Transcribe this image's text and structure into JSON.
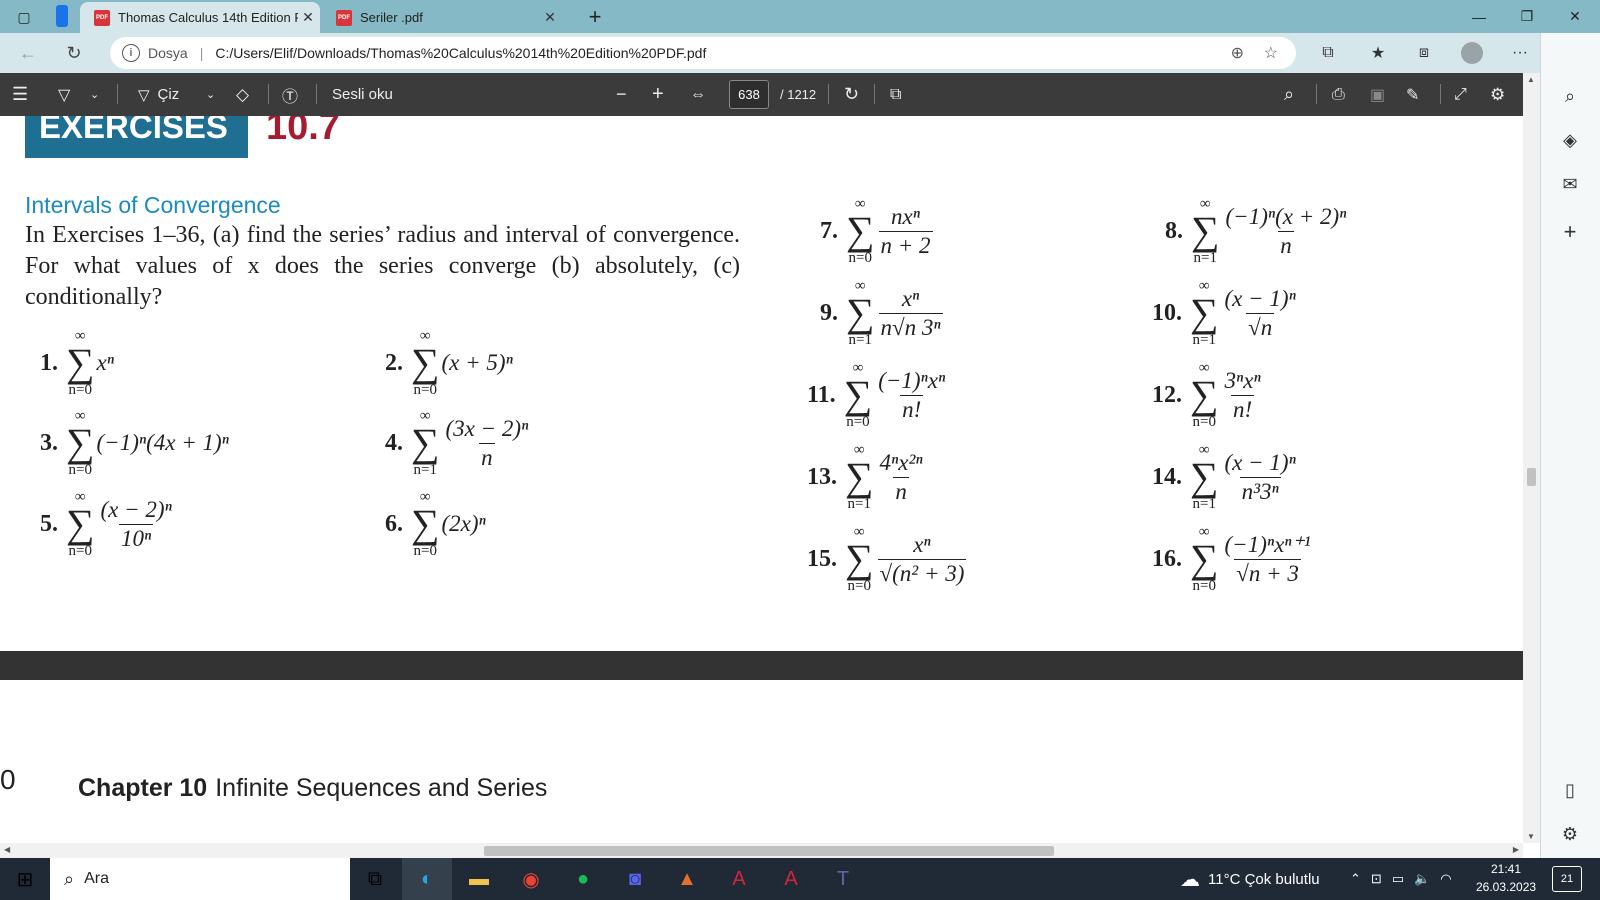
{
  "browser": {
    "tabs": [
      {
        "title": "Thomas Calculus 14th Edition PDF",
        "active": true
      },
      {
        "title": "Seriler .pdf",
        "active": false
      }
    ],
    "new_tab": "+",
    "url_prefix": "Dosya",
    "url": "C:/Users/Elif/Downloads/Thomas%20Calculus%2014th%20Edition%20PDF.pdf"
  },
  "pdf_toolbar": {
    "draw_label": "Çiz",
    "read_aloud": "Sesli oku",
    "page_current": "638",
    "page_total": "/ 1212"
  },
  "document": {
    "exercises_label": "EXERCISES",
    "section_number": "10.7",
    "section_title": "Intervals of Convergence",
    "instructions": "In Exercises 1–36, (a) find the series’ radius and interval of convergence. For what values of x does the series converge (b) absolutely, (c) conditionally?",
    "exercises": [
      {
        "n": "1.",
        "upper": "∞",
        "lower": "n=0",
        "expr": "xⁿ"
      },
      {
        "n": "2.",
        "upper": "∞",
        "lower": "n=0",
        "expr": "(x + 5)ⁿ"
      },
      {
        "n": "3.",
        "upper": "∞",
        "lower": "n=0",
        "expr": "(−1)ⁿ(4x + 1)ⁿ"
      },
      {
        "n": "4.",
        "upper": "∞",
        "lower": "n=1",
        "num": "(3x − 2)ⁿ",
        "den": "n"
      },
      {
        "n": "5.",
        "upper": "∞",
        "lower": "n=0",
        "num": "(x − 2)ⁿ",
        "den": "10ⁿ"
      },
      {
        "n": "6.",
        "upper": "∞",
        "lower": "n=0",
        "expr": "(2x)ⁿ"
      },
      {
        "n": "7.",
        "upper": "∞",
        "lower": "n=0",
        "num": "nxⁿ",
        "den": "n + 2"
      },
      {
        "n": "8.",
        "upper": "∞",
        "lower": "n=1",
        "num": "(−1)ⁿ(x + 2)ⁿ",
        "den": "n"
      },
      {
        "n": "9.",
        "upper": "∞",
        "lower": "n=1",
        "num": "xⁿ",
        "den": "n√n 3ⁿ"
      },
      {
        "n": "10.",
        "upper": "∞",
        "lower": "n=1",
        "num": "(x − 1)ⁿ",
        "den": "√n"
      },
      {
        "n": "11.",
        "upper": "∞",
        "lower": "n=0",
        "num": "(−1)ⁿxⁿ",
        "den": "n!"
      },
      {
        "n": "12.",
        "upper": "∞",
        "lower": "n=0",
        "num": "3ⁿxⁿ",
        "den": "n!"
      },
      {
        "n": "13.",
        "upper": "∞",
        "lower": "n=1",
        "num": "4ⁿx²ⁿ",
        "den": "n"
      },
      {
        "n": "14.",
        "upper": "∞",
        "lower": "n=1",
        "num": "(x − 1)ⁿ",
        "den": "n³3ⁿ"
      },
      {
        "n": "15.",
        "upper": "∞",
        "lower": "n=0",
        "num": "xⁿ",
        "den": "√(n² + 3)"
      },
      {
        "n": "16.",
        "upper": "∞",
        "lower": "n=0",
        "num": "(−1)ⁿxⁿ⁺¹",
        "den": "√n + 3"
      }
    ],
    "page_number": "0",
    "chapter_label": "Chapter 10",
    "chapter_title": "Infinite Sequences and Series"
  },
  "taskbar": {
    "search": "Ara",
    "weather": "11°C  Çok bulutlu",
    "time": "21:41",
    "date": "26.03.2023",
    "notifications": "21"
  },
  "colors": {
    "titlebar": "#85b9c6",
    "pdf_toolbar": "#3b3b3b",
    "exercises_box": "#1f6f92",
    "section_number": "#a51c30",
    "section_title": "#1b8bc1"
  }
}
